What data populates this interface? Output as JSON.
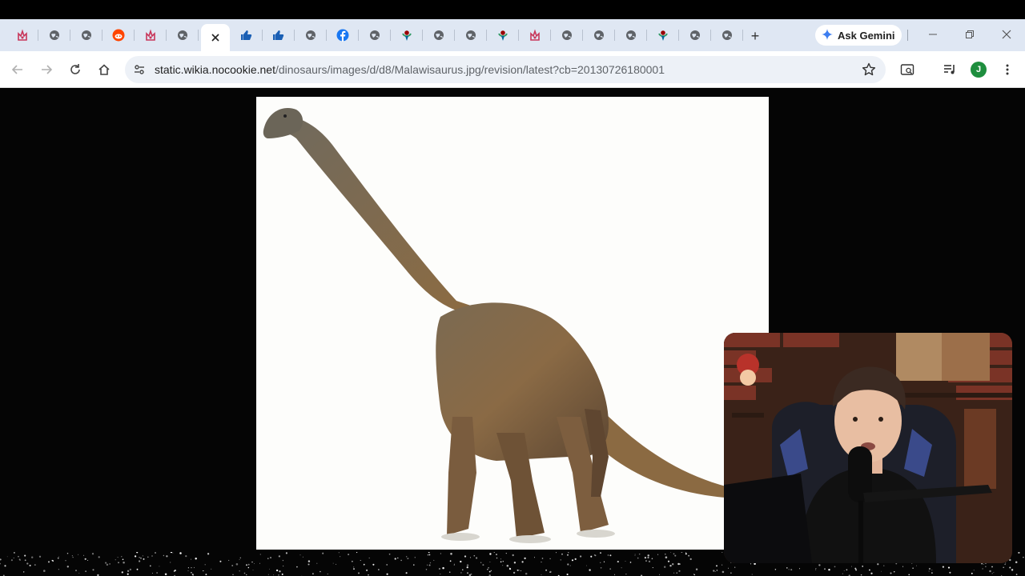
{
  "browser": {
    "tabs": [
      {
        "icon": "fandom-icon",
        "active": false
      },
      {
        "icon": "globe-icon",
        "active": false
      },
      {
        "icon": "globe-icon",
        "active": false
      },
      {
        "icon": "reddit-icon",
        "active": false
      },
      {
        "icon": "fandom-icon",
        "active": false
      },
      {
        "icon": "globe-icon",
        "active": false
      },
      {
        "icon": "close-icon",
        "active": true
      },
      {
        "icon": "thumb-icon",
        "active": false
      },
      {
        "icon": "thumb-icon",
        "active": false
      },
      {
        "icon": "globe-icon",
        "active": false
      },
      {
        "icon": "facebook-icon",
        "active": false
      },
      {
        "icon": "globe-icon",
        "active": false
      },
      {
        "icon": "wikimedia-icon",
        "active": false
      },
      {
        "icon": "globe-icon",
        "active": false
      },
      {
        "icon": "globe-icon",
        "active": false
      },
      {
        "icon": "wikimedia-icon",
        "active": false
      },
      {
        "icon": "fandom-icon",
        "active": false
      },
      {
        "icon": "globe-icon",
        "active": false
      },
      {
        "icon": "globe-icon",
        "active": false
      },
      {
        "icon": "globe-icon",
        "active": false
      },
      {
        "icon": "wikimedia-icon",
        "active": false
      },
      {
        "icon": "globe-icon",
        "active": false
      },
      {
        "icon": "globe-icon",
        "active": false
      }
    ],
    "new_tab_label": "+",
    "gemini_label": "Ask Gemini",
    "url_host": "static.wikia.nocookie.net",
    "url_path": "/dinosaurs/images/d/d8/Malawisaurus.jpg/revision/latest?cb=20130726180001",
    "profile_initial": "J",
    "colors": {
      "tabstrip": "#dfe7f3",
      "omnibox": "#edf1f7",
      "avatar": "#1e8e3e",
      "page_bg": "#050505"
    }
  }
}
